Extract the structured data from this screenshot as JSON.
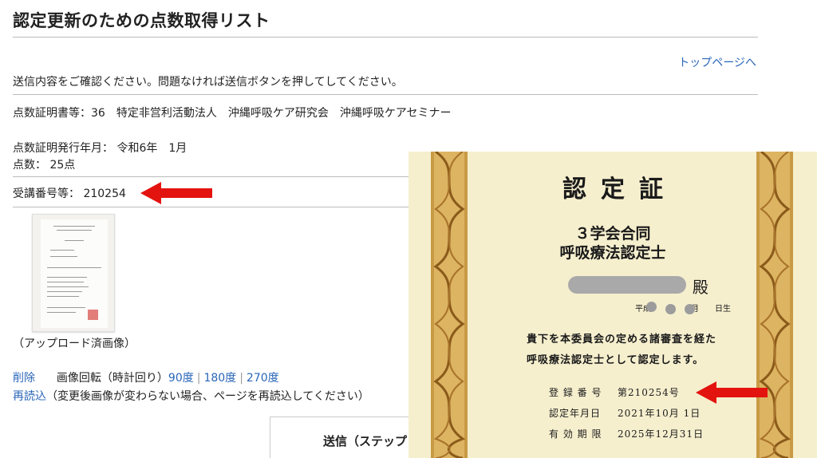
{
  "header": {
    "title": "認定更新のための点数取得リスト",
    "top_link": "トップページへ"
  },
  "confirm_message": "送信内容をご確認ください。問題なければ送信ボタンを押してしてください。",
  "certificate_source": "点数証明書等：36　特定非営利活動法人　沖縄呼吸ケア研究会　沖縄呼吸ケアセミナー",
  "issue_date": "点数証明発行年月： 令和6年　1月",
  "points": "点数： 25点",
  "registration_no": "受講番号等： 210254",
  "upload": {
    "caption": "（アップロード済画像）"
  },
  "actions": {
    "delete": "削除",
    "rotate_label": "画像回転（時計回り）",
    "rotate_90": "90度",
    "rotate_180": "180度",
    "rotate_270": "270度",
    "sep": "|",
    "reload": "再読込",
    "reload_note": "（変更後画像が変わらない場合、ページを再読込してください）"
  },
  "submit": {
    "label": "送信（ステップ"
  },
  "certificate": {
    "title": "認定証",
    "subtitle1": "３学会合同",
    "subtitle2": "呼吸療法認定士",
    "honorific": "殿",
    "birth": "平成　　年　　月　　日生",
    "body1": "貴下を本委員会の定める諸審査を経た",
    "body2": "呼吸療法認定士として認定します。",
    "reg_label": "登 録 番 号",
    "reg_value": "第210254号",
    "date_label": "認定年月日",
    "date_value": "2021年10月 1日",
    "expiry_label": "有 効 期 限",
    "expiry_value": "2025年12月31日"
  },
  "colors": {
    "link": "#2a66b8",
    "arrow": "#e3130f",
    "certificate_bg": "#f6efce",
    "border_gold": "#b8862e"
  }
}
